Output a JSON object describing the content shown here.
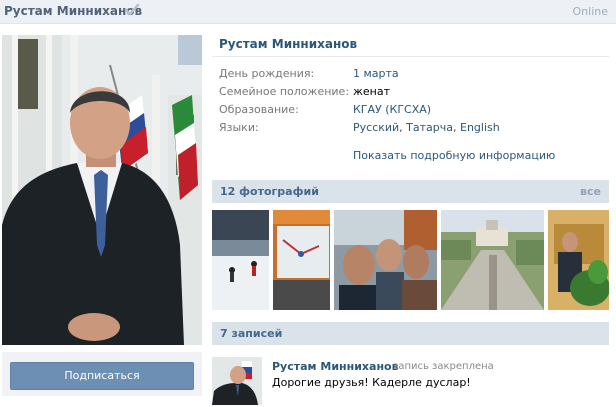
{
  "topbar": {
    "name": "Рустам Минниханов",
    "status": "Online"
  },
  "profile": {
    "name": "Рустам Минниханов",
    "info": [
      {
        "label": "День рождения:",
        "value": "1 марта",
        "link": true
      },
      {
        "label": "Семейное положение:",
        "value": "женат",
        "link": false
      },
      {
        "label": "Образование:",
        "value": "КГАУ (КГСХА)",
        "link": true
      },
      {
        "label": "Языки:",
        "value": "Русский, Татарча, English",
        "link": true
      }
    ],
    "more_info": "Показать подробную информацию"
  },
  "subscribe": {
    "label": "Подписаться"
  },
  "photos": {
    "title": "12 фотографий",
    "all_label": "все"
  },
  "posts": {
    "title": "7 записей",
    "items": [
      {
        "author": "Рустам Минниханов",
        "meta": "запись закреплена",
        "text": "Дорогие друзья! Кадерле дуслар!"
      }
    ]
  },
  "colors": {
    "link": "#2b587a",
    "section_bg": "#dae2ea",
    "button": "#6d8fb3"
  }
}
